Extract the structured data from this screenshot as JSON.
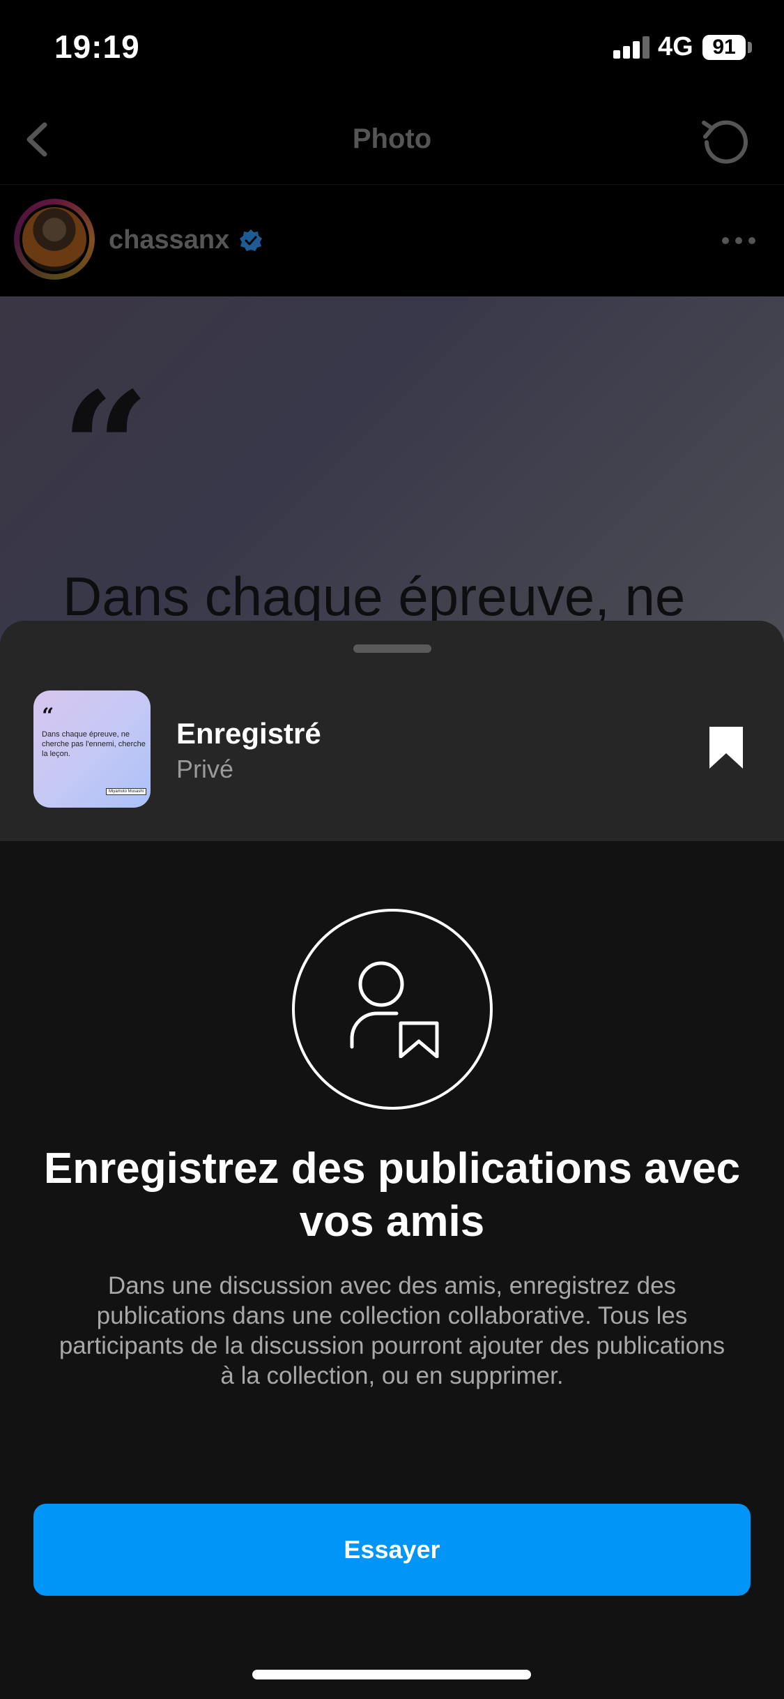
{
  "status_bar": {
    "time": "19:19",
    "network": "4G",
    "battery": "91"
  },
  "header": {
    "title": "Photo",
    "back_icon": "chevron-left-icon",
    "refresh_icon": "refresh-icon"
  },
  "post": {
    "username": "chassanx",
    "verified": true,
    "quote_mark": "“",
    "quote_text": "Dans chaque épreuve, ne"
  },
  "sheet": {
    "saved": {
      "title": "Enregistré",
      "subtitle": "Privé",
      "thumb_quote_mark": "“",
      "thumb_text": "Dans chaque épreuve, ne cherche pas l'ennemi, cherche la leçon.",
      "thumb_tag": "Miyamoto Musashi"
    },
    "promo": {
      "title": "Enregistrez des publications avec vos amis",
      "body": "Dans une discussion avec des amis, enregistrez des publications dans une collection collaborative. Tous les participants de la discussion pourront ajouter des publications à la collection, ou en supprimer."
    },
    "cta_label": "Essayer"
  },
  "colors": {
    "accent": "#0095f6",
    "sheet_bg": "#121212",
    "saved_row_bg": "#262626",
    "verified_blue": "#3897f0"
  }
}
